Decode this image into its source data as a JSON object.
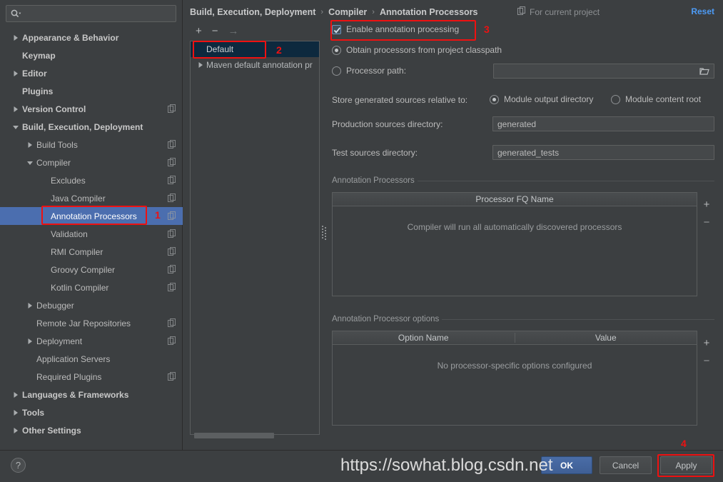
{
  "search": {
    "placeholder": "",
    "value": "",
    "icon": "search-icon"
  },
  "sidebar": {
    "items": [
      {
        "label": "Appearance & Behavior",
        "indent": 0,
        "twisty": "right",
        "bold": true,
        "copy": false,
        "selected": false
      },
      {
        "label": "Keymap",
        "indent": 0,
        "twisty": "none",
        "bold": true,
        "copy": false,
        "selected": false
      },
      {
        "label": "Editor",
        "indent": 0,
        "twisty": "right",
        "bold": true,
        "copy": false,
        "selected": false
      },
      {
        "label": "Plugins",
        "indent": 0,
        "twisty": "none",
        "bold": true,
        "copy": false,
        "selected": false
      },
      {
        "label": "Version Control",
        "indent": 0,
        "twisty": "right",
        "bold": true,
        "copy": true,
        "selected": false
      },
      {
        "label": "Build, Execution, Deployment",
        "indent": 0,
        "twisty": "down",
        "bold": true,
        "copy": false,
        "selected": false
      },
      {
        "label": "Build Tools",
        "indent": 1,
        "twisty": "right",
        "bold": false,
        "copy": true,
        "selected": false
      },
      {
        "label": "Compiler",
        "indent": 1,
        "twisty": "down",
        "bold": false,
        "copy": true,
        "selected": false
      },
      {
        "label": "Excludes",
        "indent": 2,
        "twisty": "none",
        "bold": false,
        "copy": true,
        "selected": false
      },
      {
        "label": "Java Compiler",
        "indent": 2,
        "twisty": "none",
        "bold": false,
        "copy": true,
        "selected": false
      },
      {
        "label": "Annotation Processors",
        "indent": 2,
        "twisty": "none",
        "bold": false,
        "copy": true,
        "selected": true
      },
      {
        "label": "Validation",
        "indent": 2,
        "twisty": "none",
        "bold": false,
        "copy": true,
        "selected": false
      },
      {
        "label": "RMI Compiler",
        "indent": 2,
        "twisty": "none",
        "bold": false,
        "copy": true,
        "selected": false
      },
      {
        "label": "Groovy Compiler",
        "indent": 2,
        "twisty": "none",
        "bold": false,
        "copy": true,
        "selected": false
      },
      {
        "label": "Kotlin Compiler",
        "indent": 2,
        "twisty": "none",
        "bold": false,
        "copy": true,
        "selected": false
      },
      {
        "label": "Debugger",
        "indent": 1,
        "twisty": "right",
        "bold": false,
        "copy": false,
        "selected": false
      },
      {
        "label": "Remote Jar Repositories",
        "indent": 1,
        "twisty": "none",
        "bold": false,
        "copy": true,
        "selected": false
      },
      {
        "label": "Deployment",
        "indent": 1,
        "twisty": "right",
        "bold": false,
        "copy": true,
        "selected": false
      },
      {
        "label": "Application Servers",
        "indent": 1,
        "twisty": "none",
        "bold": false,
        "copy": false,
        "selected": false
      },
      {
        "label": "Required Plugins",
        "indent": 1,
        "twisty": "none",
        "bold": false,
        "copy": true,
        "selected": false
      },
      {
        "label": "Languages & Frameworks",
        "indent": 0,
        "twisty": "right",
        "bold": true,
        "copy": false,
        "selected": false
      },
      {
        "label": "Tools",
        "indent": 0,
        "twisty": "right",
        "bold": true,
        "copy": false,
        "selected": false
      },
      {
        "label": "Other Settings",
        "indent": 0,
        "twisty": "right",
        "bold": true,
        "copy": false,
        "selected": false
      }
    ],
    "help_label": "?"
  },
  "header": {
    "breadcrumb": [
      "Build, Execution, Deployment",
      "Compiler",
      "Annotation Processors"
    ],
    "separator": "›",
    "scope_label": "For current project",
    "scope_icon": "copy-icon",
    "reset_label": "Reset"
  },
  "profiles": {
    "toolbar": {
      "add": "+",
      "remove": "−",
      "move": "→"
    },
    "items": [
      {
        "label": "Default",
        "twisty": "none",
        "selected": true
      },
      {
        "label": "Maven default annotation pr",
        "twisty": "right",
        "selected": false
      }
    ]
  },
  "settings": {
    "enable_label": "Enable annotation processing",
    "enable_checked": true,
    "source_options": [
      {
        "label": "Obtain processors from project classpath",
        "selected": true
      },
      {
        "label": "Processor path:",
        "selected": false
      }
    ],
    "processor_path_value": "",
    "store_label": "Store generated sources relative to:",
    "store_options": [
      {
        "label": "Module output directory",
        "selected": true
      },
      {
        "label": "Module content root",
        "selected": false
      }
    ],
    "production_label": "Production sources directory:",
    "production_value": "generated",
    "test_label": "Test sources directory:",
    "test_value": "generated_tests"
  },
  "processors_table": {
    "section_title": "Annotation Processors",
    "columns": [
      "Processor FQ Name"
    ],
    "rows": [],
    "empty_text": "Compiler will run all automatically discovered processors",
    "add": "+",
    "remove": "−"
  },
  "options_table": {
    "section_title": "Annotation Processor options",
    "columns": [
      "Option Name",
      "Value"
    ],
    "rows": [],
    "empty_text": "No processor-specific options configured",
    "add": "+",
    "remove": "−"
  },
  "footer": {
    "ok_label": "OK",
    "cancel_label": "Cancel",
    "apply_label": "Apply"
  },
  "annotations": {
    "items": [
      {
        "num": "1"
      },
      {
        "num": "2"
      },
      {
        "num": "3"
      },
      {
        "num": "4"
      }
    ],
    "color": "#ee1111"
  },
  "watermark": {
    "text": "https://sowhat.blog.csdn.net"
  }
}
